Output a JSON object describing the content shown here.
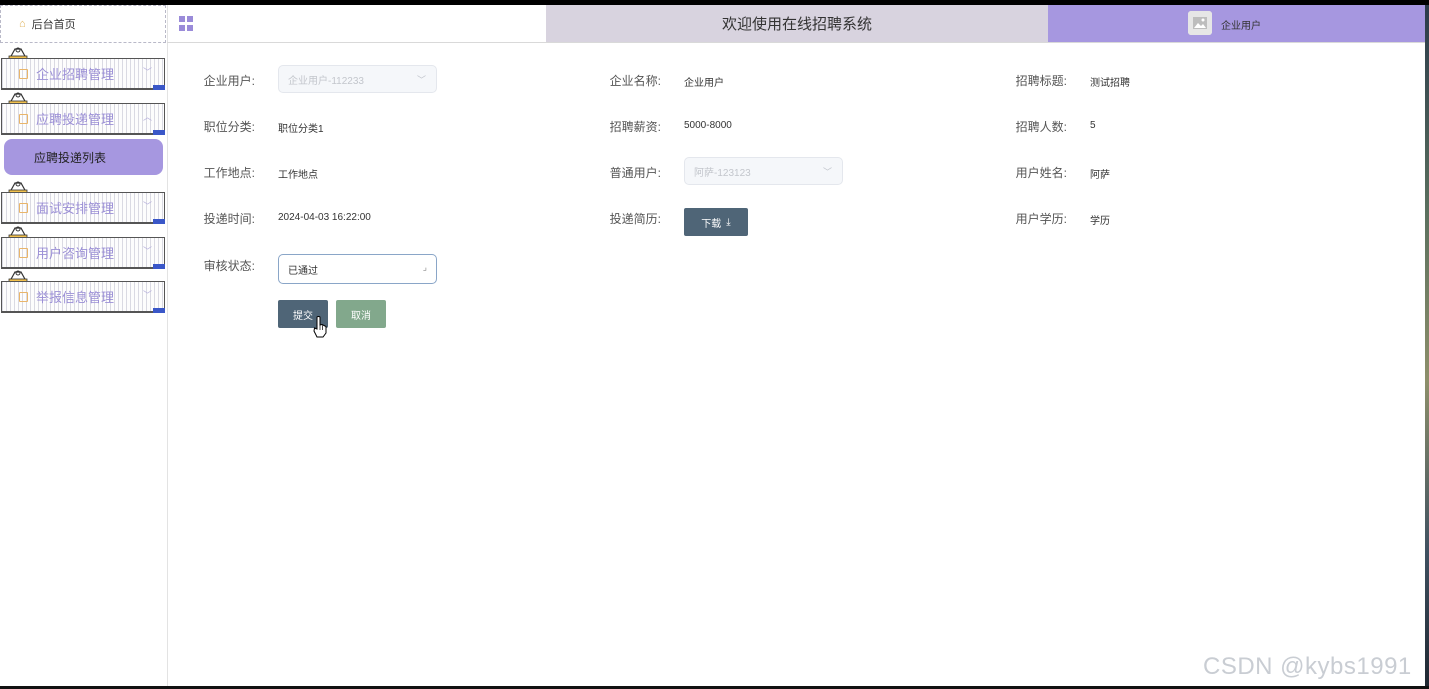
{
  "header": {
    "title": "欢迎使用在线招聘系统",
    "user_label": "企业用户"
  },
  "sidebar": {
    "home_label": "后台首页",
    "menus": [
      {
        "label": "企业招聘管理"
      },
      {
        "label": "应聘投递管理"
      },
      {
        "label": "面试安排管理"
      },
      {
        "label": "用户咨询管理"
      },
      {
        "label": "举报信息管理"
      }
    ],
    "active_submenu": "应聘投递列表"
  },
  "form": {
    "company_user": {
      "label": "企业用户:",
      "value": "企业用户-112233"
    },
    "company_name": {
      "label": "企业名称:",
      "value": "企业用户"
    },
    "recruit_title": {
      "label": "招聘标题:",
      "value": "测试招聘"
    },
    "job_category": {
      "label": "职位分类:",
      "value": "职位分类1"
    },
    "salary": {
      "label": "招聘薪资:",
      "value": "5000-8000"
    },
    "headcount": {
      "label": "招聘人数:",
      "value": "5"
    },
    "work_location": {
      "label": "工作地点:",
      "value": "工作地点"
    },
    "normal_user": {
      "label": "普通用户:",
      "value": "阿萨-123123"
    },
    "user_name": {
      "label": "用户姓名:",
      "value": "阿萨"
    },
    "submit_time": {
      "label": "投递时间:",
      "value": "2024-04-03 16:22:00"
    },
    "resume": {
      "label": "投递简历:",
      "button": "下载"
    },
    "education": {
      "label": "用户学历:",
      "value": "学历"
    },
    "review_status": {
      "label": "审核状态:",
      "value": "已通过"
    }
  },
  "buttons": {
    "submit": "提交",
    "cancel": "取消"
  },
  "watermark": "CSDN @kybs1991"
}
